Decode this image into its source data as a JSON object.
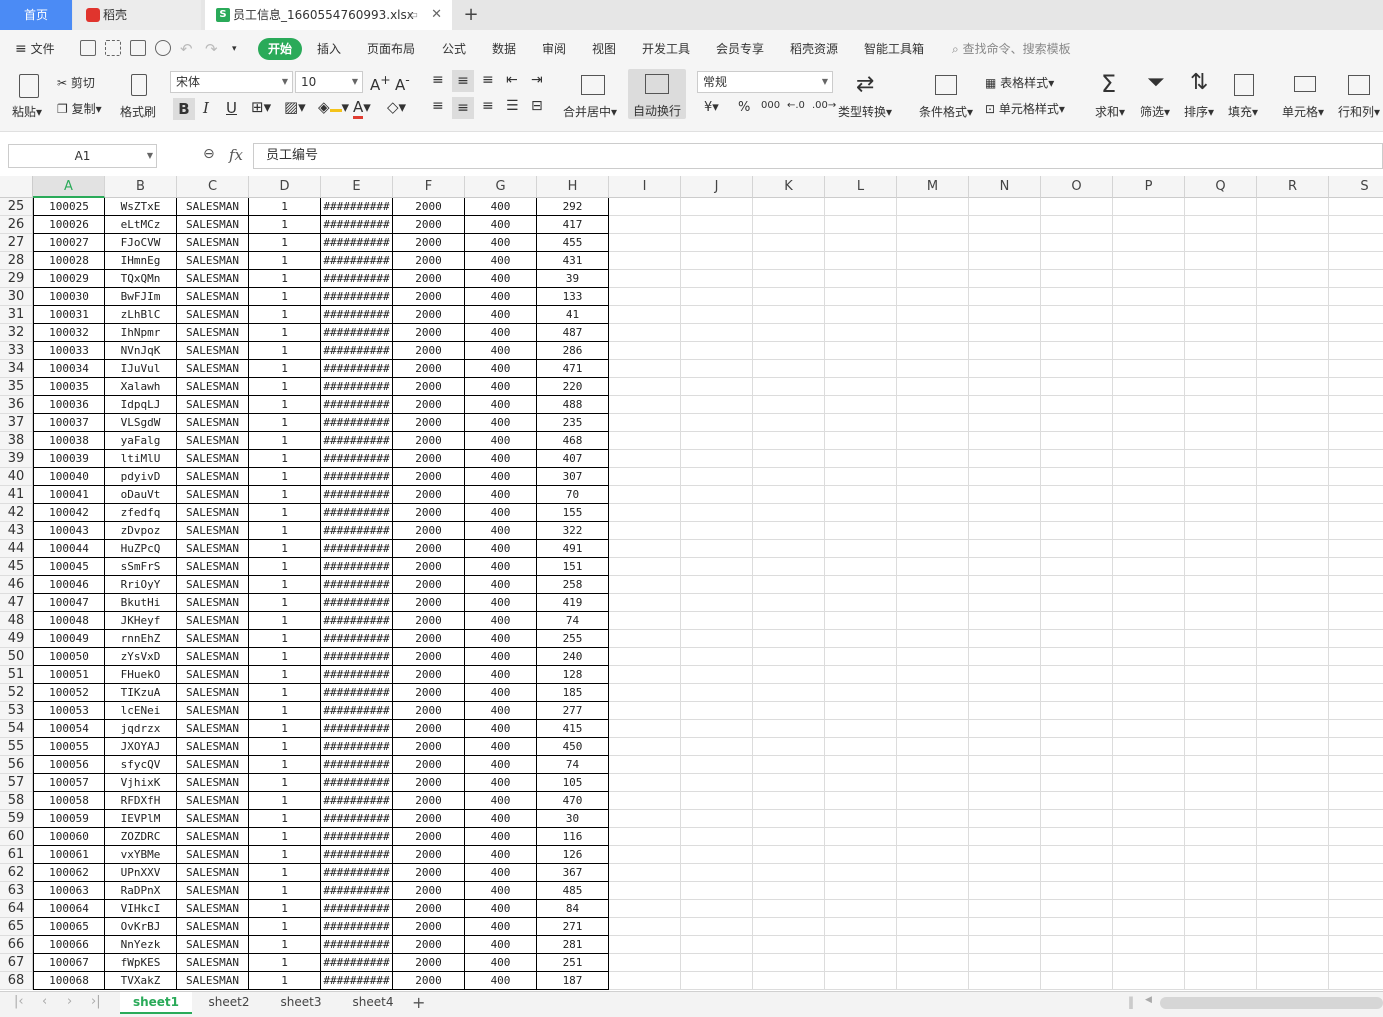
{
  "tabs": {
    "home": "首页",
    "daoke": "稻壳",
    "file": "员工信息_1660554760993.xlsx",
    "file_icon": "S",
    "add": "+"
  },
  "menu": {
    "file": "文件",
    "items": [
      "开始",
      "插入",
      "页面布局",
      "公式",
      "数据",
      "审阅",
      "视图",
      "开发工具",
      "会员专享",
      "稻壳资源",
      "智能工具箱"
    ],
    "search": "查找命令、搜索模板"
  },
  "ribbon": {
    "paste": "粘贴",
    "cut": "剪切",
    "copy": "复制",
    "format_painter": "格式刷",
    "font_name": "宋体",
    "font_size": "10",
    "merge": "合并居中",
    "wrap": "自动换行",
    "number_format": "常规",
    "type_convert": "类型转换",
    "cond_format": "条件格式",
    "table_style": "表格样式",
    "cell_style": "单元格样式",
    "sum": "求和",
    "filter": "筛选",
    "sort": "排序",
    "fill": "填充",
    "cell": "单元格",
    "rowcol": "行和列",
    "currency": "¥",
    "percent": "%",
    "thousands": "000"
  },
  "formula": {
    "namebox": "A1",
    "fx": "fx",
    "content": "员工编号"
  },
  "columns": [
    "A",
    "B",
    "C",
    "D",
    "E",
    "F",
    "G",
    "H",
    "I",
    "J",
    "K",
    "L",
    "M",
    "N",
    "O",
    "P",
    "Q",
    "R",
    "S"
  ],
  "rows": [
    {
      "r": "25",
      "a": "100025",
      "b": "WsZTxE",
      "h": "292"
    },
    {
      "r": "26",
      "a": "100026",
      "b": "eLtMCz",
      "h": "417"
    },
    {
      "r": "27",
      "a": "100027",
      "b": "FJoCVW",
      "h": "455"
    },
    {
      "r": "28",
      "a": "100028",
      "b": "IHmnEg",
      "h": "431"
    },
    {
      "r": "29",
      "a": "100029",
      "b": "TQxQMn",
      "h": "39"
    },
    {
      "r": "30",
      "a": "100030",
      "b": "BwFJIm",
      "h": "133"
    },
    {
      "r": "31",
      "a": "100031",
      "b": "zLhBlC",
      "h": "41"
    },
    {
      "r": "32",
      "a": "100032",
      "b": "IhNpmr",
      "h": "487"
    },
    {
      "r": "33",
      "a": "100033",
      "b": "NVnJqK",
      "h": "286"
    },
    {
      "r": "34",
      "a": "100034",
      "b": "IJuVul",
      "h": "471"
    },
    {
      "r": "35",
      "a": "100035",
      "b": "Xalawh",
      "h": "220"
    },
    {
      "r": "36",
      "a": "100036",
      "b": "IdpqLJ",
      "h": "488"
    },
    {
      "r": "37",
      "a": "100037",
      "b": "VLSgdW",
      "h": "235"
    },
    {
      "r": "38",
      "a": "100038",
      "b": "yaFalg",
      "h": "468"
    },
    {
      "r": "39",
      "a": "100039",
      "b": "ltiMlU",
      "h": "407"
    },
    {
      "r": "40",
      "a": "100040",
      "b": "pdyivD",
      "h": "307"
    },
    {
      "r": "41",
      "a": "100041",
      "b": "oDauVt",
      "h": "70"
    },
    {
      "r": "42",
      "a": "100042",
      "b": "zfedfq",
      "h": "155"
    },
    {
      "r": "43",
      "a": "100043",
      "b": "zDvpoz",
      "h": "322"
    },
    {
      "r": "44",
      "a": "100044",
      "b": "HuZPcQ",
      "h": "491"
    },
    {
      "r": "45",
      "a": "100045",
      "b": "sSmFrS",
      "h": "151"
    },
    {
      "r": "46",
      "a": "100046",
      "b": "RriOyY",
      "h": "258"
    },
    {
      "r": "47",
      "a": "100047",
      "b": "BkutHi",
      "h": "419"
    },
    {
      "r": "48",
      "a": "100048",
      "b": "JKHeyf",
      "h": "74"
    },
    {
      "r": "49",
      "a": "100049",
      "b": "rnnEhZ",
      "h": "255"
    },
    {
      "r": "50",
      "a": "100050",
      "b": "zYsVxD",
      "h": "240"
    },
    {
      "r": "51",
      "a": "100051",
      "b": "FHuekO",
      "h": "128"
    },
    {
      "r": "52",
      "a": "100052",
      "b": "TIKzuA",
      "h": "185"
    },
    {
      "r": "53",
      "a": "100053",
      "b": "lcENei",
      "h": "277"
    },
    {
      "r": "54",
      "a": "100054",
      "b": "jqdrzx",
      "h": "415"
    },
    {
      "r": "55",
      "a": "100055",
      "b": "JXOYAJ",
      "h": "450"
    },
    {
      "r": "56",
      "a": "100056",
      "b": "sfycQV",
      "h": "74"
    },
    {
      "r": "57",
      "a": "100057",
      "b": "VjhixK",
      "h": "105"
    },
    {
      "r": "58",
      "a": "100058",
      "b": "RFDXfH",
      "h": "470"
    },
    {
      "r": "59",
      "a": "100059",
      "b": "IEVPlM",
      "h": "30"
    },
    {
      "r": "60",
      "a": "100060",
      "b": "ZOZDRC",
      "h": "116"
    },
    {
      "r": "61",
      "a": "100061",
      "b": "vxYBMe",
      "h": "126"
    },
    {
      "r": "62",
      "a": "100062",
      "b": "UPnXXV",
      "h": "367"
    },
    {
      "r": "63",
      "a": "100063",
      "b": "RaDPnX",
      "h": "485"
    },
    {
      "r": "64",
      "a": "100064",
      "b": "VIHkcI",
      "h": "84"
    },
    {
      "r": "65",
      "a": "100065",
      "b": "OvKrBJ",
      "h": "271"
    },
    {
      "r": "66",
      "a": "100066",
      "b": "NnYezk",
      "h": "281"
    },
    {
      "r": "67",
      "a": "100067",
      "b": "fWpKES",
      "h": "251"
    },
    {
      "r": "68",
      "a": "100068",
      "b": "TVXakZ",
      "h": "187"
    }
  ],
  "common": {
    "c": "SALESMAN",
    "d": "1",
    "e": "##########",
    "f": "2000",
    "g": "400"
  },
  "sheets": [
    "sheet1",
    "sheet2",
    "sheet3",
    "sheet4"
  ],
  "active_sheet": "sheet1",
  "colors": {
    "accent_green": "#2aaa59",
    "home_tab_blue": "#4b8bf5"
  }
}
